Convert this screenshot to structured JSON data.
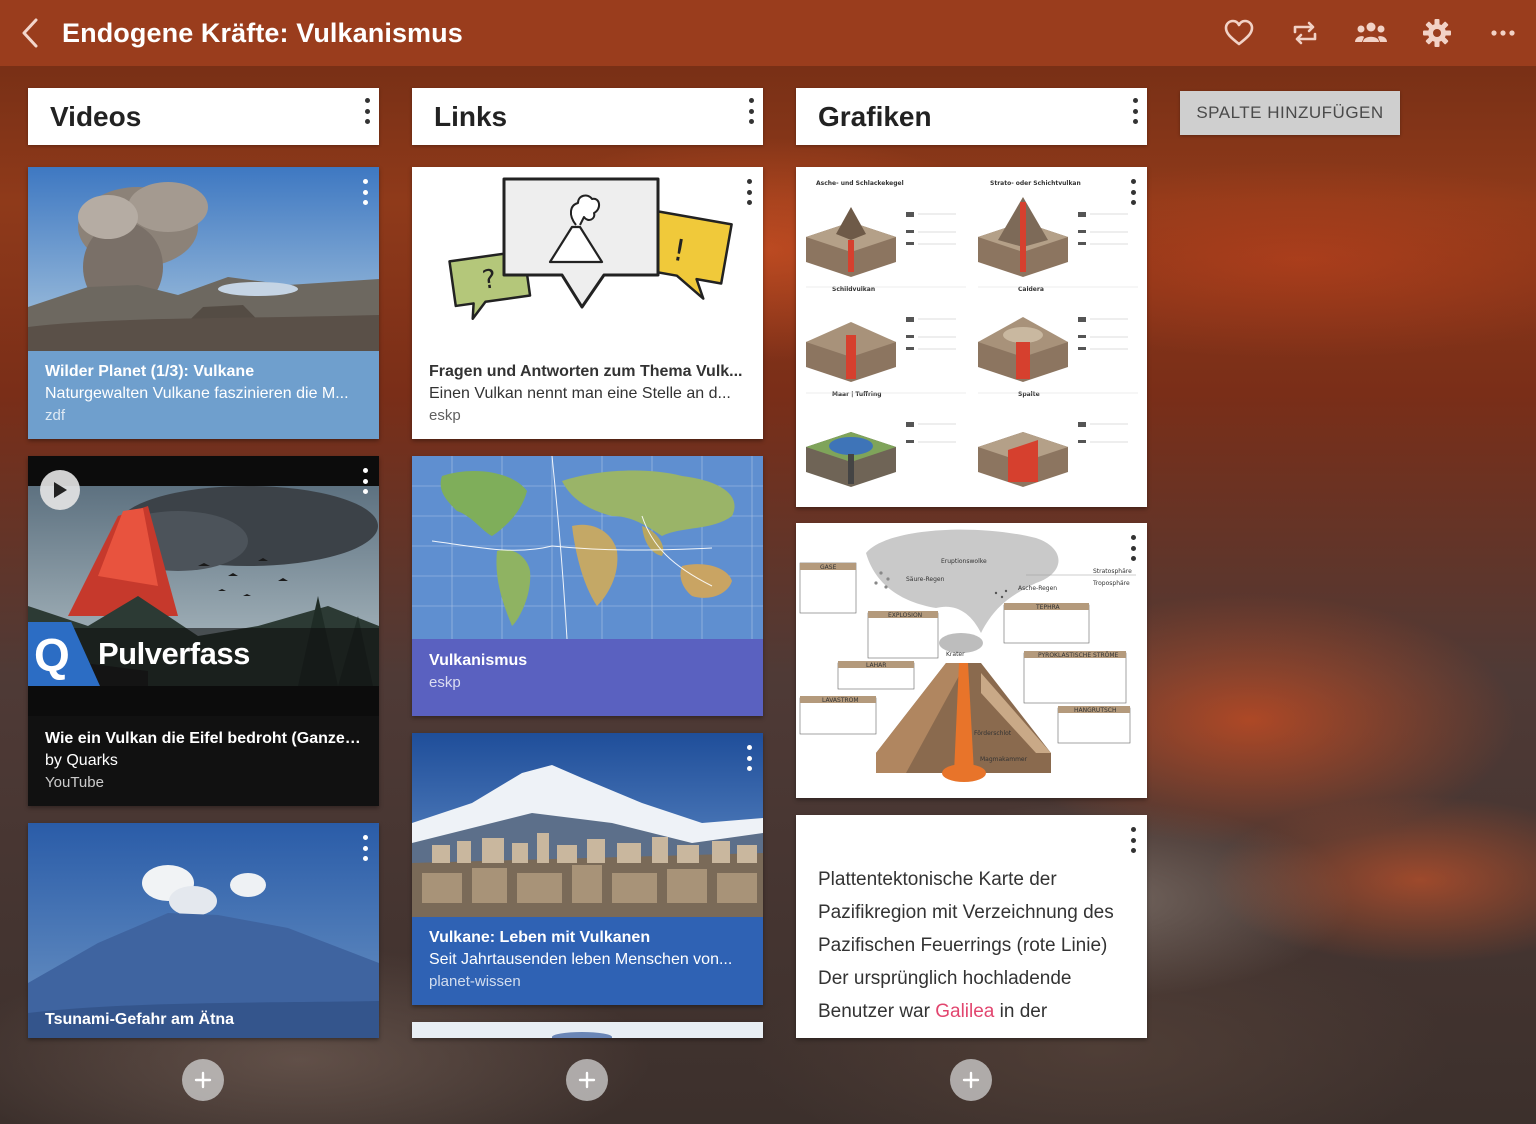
{
  "header": {
    "title": "Endogene Kräfte: Vulkanismus",
    "background_color": "#9a3d1d"
  },
  "actions": [
    {
      "icon": "heart-icon"
    },
    {
      "icon": "repost-icon"
    },
    {
      "icon": "people-icon"
    },
    {
      "icon": "gear-icon"
    },
    {
      "icon": "more-icon"
    }
  ],
  "add_column_label": "SPALTE HINZUFÜGEN",
  "columns": {
    "videos": {
      "title": "Videos",
      "cards": [
        {
          "title": "Wilder Planet (1/3): Vulkane",
          "description": "Naturgewalten Vulkane faszinieren die M...",
          "source": "zdf",
          "color": "#6f9fcd"
        },
        {
          "overlay_text": "Pulverfass",
          "logo_letter": "Q",
          "title": "Wie ein Vulkan die Eifel bedroht (Ganze ...",
          "description": "by Quarks",
          "source": "YouTube",
          "color": "#111111"
        },
        {
          "title": "Tsunami-Gefahr am Ätna"
        }
      ]
    },
    "links": {
      "title": "Links",
      "cards": [
        {
          "title": "Fragen und Antworten zum Thema Vulk...",
          "description": "Einen Vulkan nennt man eine Stelle an d...",
          "source": "eskp",
          "color": "#ffffff"
        },
        {
          "title": "Vulkanismus",
          "source": "eskp",
          "color": "#5a61c0"
        },
        {
          "title": "Vulkane: Leben mit Vulkanen",
          "description": "Seit Jahrtausenden leben Menschen von...",
          "source": "planet-wissen",
          "color": "#2f62b4"
        }
      ]
    },
    "grafiken": {
      "title": "Grafiken",
      "cards": [
        {
          "type": "image"
        },
        {
          "type": "image"
        },
        {
          "type": "note",
          "lines": [
            "Plattentektonische Karte der",
            "Pazifikregion mit Verzeichnung des",
            "Pazifischen Feuerrings (rote Linie)",
            "Der ursprünglich hochladende"
          ],
          "line5_before": "Benutzer war ",
          "line5_link": "Galilea",
          "line5_after": " in der",
          "link_color": "#e2466f"
        }
      ]
    }
  },
  "volcano_diagram": {
    "titles": [
      "Asche- und Schlackekegel",
      "Strato- oder Schichtvulkan",
      "Schildvulkan",
      "Caldera",
      "Maar | Tuffring",
      "Spalte"
    ]
  },
  "eruption_diagram": {
    "labels": [
      "Eruptionswolke",
      "Stratosphäre",
      "Troposphäre",
      "GASE",
      "EXPLOSION",
      "TEPHRA",
      "LAHAR",
      "PYROKLASTISCHE STRÖME",
      "LAVASTROM",
      "HANGRUTSCH",
      "Krater",
      "Förderschlot",
      "Magmakammer",
      "Säure-Regen",
      "Asche-Regen"
    ]
  }
}
